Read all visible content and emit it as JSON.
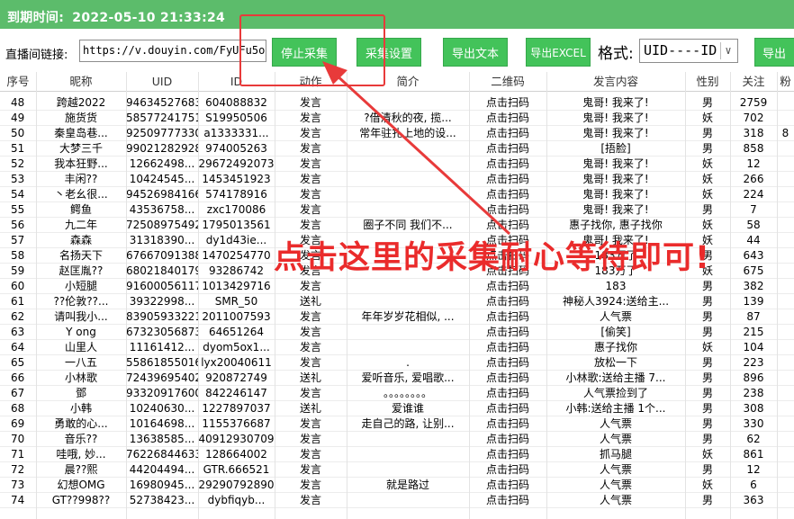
{
  "titlebar": {
    "label": "到期时间:",
    "value": "2022-05-10 21:33:24"
  },
  "toolbar": {
    "url_label": "直播间链接:",
    "url_value": "https://v.douyin.com/FyUFu5o/",
    "buttons": [
      "停止采集",
      "采集设置",
      "导出文本",
      "导出EXCEL",
      "导出"
    ],
    "format_label": "格式:",
    "format_value": "UID----ID"
  },
  "table": {
    "columns": [
      "序号",
      "昵称",
      "UID",
      "ID",
      "动作",
      "简介",
      "二维码",
      "发言内容",
      "性别",
      "关注",
      "粉"
    ],
    "rows": [
      [
        "48",
        "跨越2022",
        "94634527683",
        "604088832",
        "发言",
        "",
        "点击扫码",
        "鬼哥! 我来了!",
        "男",
        "2759",
        ""
      ],
      [
        "49",
        "施货货",
        "58577241751",
        "S19950506",
        "发言",
        "?借清秋的夜, 揽...",
        "点击扫码",
        "鬼哥! 我来了!",
        "妖",
        "702",
        ""
      ],
      [
        "50",
        "秦皇岛巷...",
        "92509777330",
        "a1333331...",
        "发言",
        "常年驻扎上地的设...",
        "点击扫码",
        "鬼哥! 我来了!",
        "男",
        "318",
        "8"
      ],
      [
        "51",
        "大梦三千",
        "99021282928",
        "974005263",
        "发言",
        "",
        "点击扫码",
        "[捂脸]",
        "男",
        "858",
        ""
      ],
      [
        "52",
        "我本狂野...",
        "12662498...",
        "29672492073",
        "发言",
        "",
        "点击扫码",
        "鬼哥! 我来了!",
        "妖",
        "12",
        ""
      ],
      [
        "53",
        "丰闲??",
        "10424545...",
        "1453451923",
        "发言",
        "",
        "点击扫码",
        "鬼哥! 我来了!",
        "妖",
        "266",
        ""
      ],
      [
        "54",
        "丶老幺很...",
        "94526984166",
        "574178916",
        "发言",
        "",
        "点击扫码",
        "鬼哥! 我来了!",
        "妖",
        "224",
        ""
      ],
      [
        "55",
        "鳄鱼",
        "43536758...",
        "zxc170086",
        "发言",
        "",
        "点击扫码",
        "鬼哥! 我来了!",
        "男",
        "7",
        ""
      ],
      [
        "56",
        "九二年",
        "72508975492",
        "1795013561",
        "发言",
        "圈子不同 我们不...",
        "点击扫码",
        "惠子找你, 惠子找你",
        "妖",
        "58",
        ""
      ],
      [
        "57",
        "森森",
        "31318390...",
        "dy1d43ie...",
        "发言",
        "",
        "点击扫码",
        "鬼哥! 我来了!",
        "妖",
        "44",
        ""
      ],
      [
        "58",
        "名扬天下",
        "67667091388",
        "1470254770",
        "发言",
        "",
        "点击扫码",
        "183万了",
        "男",
        "643",
        ""
      ],
      [
        "59",
        "赵匡胤??",
        "68021840179",
        "93286742",
        "发言",
        "",
        "点击扫码",
        "183万了",
        "妖",
        "675",
        ""
      ],
      [
        "60",
        "小短腿",
        "91600056117",
        "1013429716",
        "发言",
        "",
        "点击扫码",
        "183",
        "男",
        "382",
        ""
      ],
      [
        "61",
        "??伦敦??...",
        "39322998...",
        "SMR_50",
        "送礼",
        "",
        "点击扫码",
        "神秘人3924:送给主...",
        "男",
        "139",
        ""
      ],
      [
        "62",
        "请叫我小...",
        "83905933221",
        "2011007593",
        "发言",
        "年年岁岁花相似, ...",
        "点击扫码",
        "人气票",
        "男",
        "87",
        ""
      ],
      [
        "63",
        "Y ong",
        "67323056873",
        "64651264",
        "发言",
        "",
        "点击扫码",
        "[偷笑]",
        "男",
        "215",
        ""
      ],
      [
        "64",
        "山里人",
        "11161412...",
        "dyom5ox1...",
        "发言",
        "",
        "点击扫码",
        "惠子找你",
        "妖",
        "104",
        ""
      ],
      [
        "65",
        "一八五",
        "55861855016",
        "lyx20040611",
        "发言",
        ".",
        "点击扫码",
        "放松一下",
        "男",
        "223",
        ""
      ],
      [
        "66",
        "小林歌",
        "72439695402",
        "920872749",
        "送礼",
        "爱听音乐, 爱唱歌...",
        "点击扫码",
        "小林歌:送给主播 7...",
        "男",
        "896",
        ""
      ],
      [
        "67",
        "鄧",
        "93320917600",
        "842246147",
        "发言",
        "。。。。。。。。",
        "点击扫码",
        "人气票捡到了",
        "男",
        "238",
        ""
      ],
      [
        "68",
        "小韩",
        "10240630...",
        "1227897037",
        "送礼",
        "爱谁谁",
        "点击扫码",
        "小韩:送给主播 1个...",
        "男",
        "308",
        ""
      ],
      [
        "69",
        "勇敢的心...",
        "10164698...",
        "1155376687",
        "发言",
        "走自己的路, 让别...",
        "点击扫码",
        "人气票",
        "男",
        "330",
        ""
      ],
      [
        "70",
        "音乐??",
        "13638585...",
        "40912930709",
        "发言",
        "",
        "点击扫码",
        "人气票",
        "男",
        "62",
        ""
      ],
      [
        "71",
        "哇哦, 妙...",
        "76226844633",
        "128664002",
        "发言",
        "",
        "点击扫码",
        "抓马腿",
        "妖",
        "861",
        ""
      ],
      [
        "72",
        "晨??熙",
        "44204494...",
        "GTR.666521",
        "发言",
        "",
        "点击扫码",
        "人气票",
        "男",
        "12",
        ""
      ],
      [
        "73",
        "幻想OMG",
        "16980945...",
        "29290792890",
        "发言",
        "就是路过",
        "点击扫码",
        "人气票",
        "妖",
        "6",
        ""
      ],
      [
        "74",
        "GT??998??",
        "52738423...",
        "dybfiqyb...",
        "发言",
        "",
        "点击扫码",
        "人气票",
        "男",
        "363",
        ""
      ]
    ]
  },
  "annotation": {
    "callout": "点击这里的采集耐心等待即可!"
  },
  "colors": {
    "titlebar": "#5cbc6b",
    "button": "#43c35a",
    "annotation": "#e83a3a"
  }
}
